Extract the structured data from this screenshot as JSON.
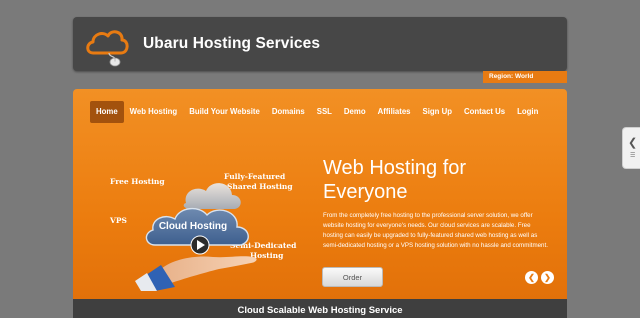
{
  "header": {
    "site_title": "Ubaru Hosting Services",
    "logo_icon": "cloud-mouse-icon",
    "region_label": "Region: World"
  },
  "nav": {
    "items": [
      {
        "label": "Home",
        "active": true
      },
      {
        "label": "Web Hosting",
        "active": false
      },
      {
        "label": "Build Your Website",
        "active": false
      },
      {
        "label": "Domains",
        "active": false
      },
      {
        "label": "SSL",
        "active": false
      },
      {
        "label": "Demo",
        "active": false
      },
      {
        "label": "Affiliates",
        "active": false
      },
      {
        "label": "Sign Up",
        "active": false
      },
      {
        "label": "Contact Us",
        "active": false
      },
      {
        "label": "Login",
        "active": false
      }
    ]
  },
  "hero": {
    "labels": {
      "free_hosting": "Free Hosting",
      "fully_featured": "Fully-Featured",
      "shared_hosting": "Shared Hosting",
      "vps": "VPS",
      "cloud_hosting": "Cloud Hosting",
      "semi_dedicated": "Semi-Dedicated",
      "hosting": "Hosting"
    },
    "title_line1": "Web Hosting for",
    "title_line2": "Everyone",
    "description": "From the completely free hosting to the professional server solution, we offer website hosting for everyone's needs. Our cloud services are scalable. Free hosting can easily be upgraded to fully-featured shared web hosting as well as semi-dedicated hosting or a VPS hosting solution with no hassle and commitment.",
    "order_label": "Order",
    "prev_icon": "chevron-left-icon",
    "next_icon": "chevron-right-icon"
  },
  "bottom": {
    "tagline": "Cloud Scalable Web Hosting Service"
  },
  "side_tab": {
    "icon": "chevron-left-icon"
  },
  "colors": {
    "accent_orange": "#ec7d0f",
    "header_dark": "#474747",
    "page_bg": "#7a7a7a"
  }
}
